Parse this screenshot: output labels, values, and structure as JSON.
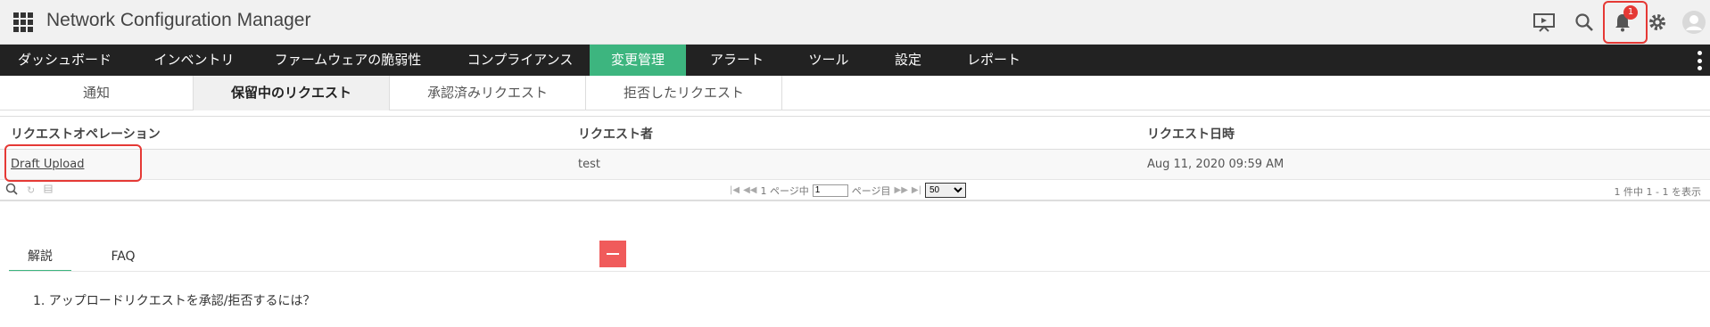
{
  "app": {
    "title": "Network Configuration Manager",
    "notification_count": "1"
  },
  "nav": {
    "items": [
      {
        "label": "ダッシュボード"
      },
      {
        "label": "インベントリ"
      },
      {
        "label": "ファームウェアの脆弱性"
      },
      {
        "label": "コンプライアンス"
      },
      {
        "label": "変更管理"
      },
      {
        "label": "アラート"
      },
      {
        "label": "ツール"
      },
      {
        "label": "設定"
      },
      {
        "label": "レポート"
      }
    ],
    "active": "変更管理"
  },
  "subtabs": [
    {
      "label": "通知"
    },
    {
      "label": "保留中のリクエスト"
    },
    {
      "label": "承認済みリクエスト"
    },
    {
      "label": "拒否したリクエスト"
    }
  ],
  "table": {
    "columns": [
      "リクエストオペレーション",
      "リクエスト者",
      "リクエスト日時"
    ],
    "rows": [
      {
        "operation": "Draft Upload",
        "requester": "test",
        "datetime": "Aug 11, 2020 09:59 AM"
      }
    ]
  },
  "pager": {
    "page_prefix": "1 ページ中",
    "page_value": "1",
    "page_suffix": "ページ目",
    "page_size": "50",
    "summary": "1 件中 1 - 1 を表示"
  },
  "help": {
    "tabs": [
      {
        "label": "解説"
      },
      {
        "label": "FAQ"
      }
    ],
    "item": "1. アップロードリクエストを承認/拒否するには？"
  },
  "colors": {
    "accent": "#3db57f",
    "alert": "#e53935",
    "navbar": "#222222"
  }
}
